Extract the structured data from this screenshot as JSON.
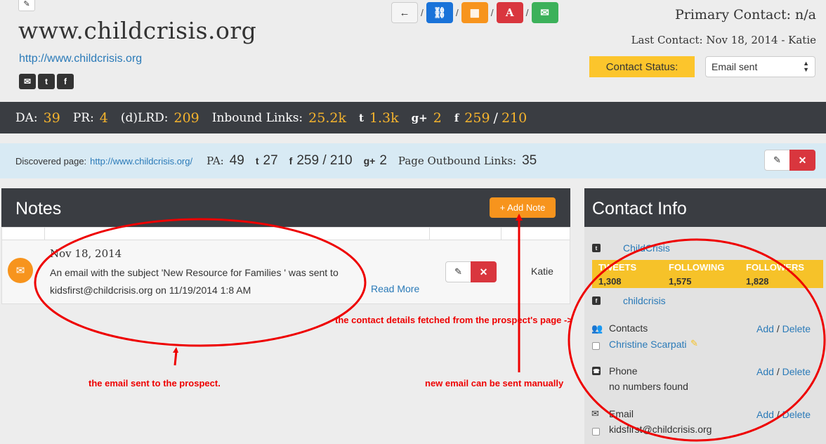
{
  "header": {
    "site_title": "www.childcrisis.org",
    "site_url": "http://www.childcrisis.org",
    "primary_contact": "Primary Contact: n/a",
    "last_contact": "Last Contact: Nov 18, 2014 - Katie",
    "contact_status_label": "Contact Status:",
    "contact_status_value": "Email sent",
    "social_icons": [
      "email-icon",
      "twitter-icon",
      "facebook-icon"
    ],
    "actions": [
      {
        "icon": "arrow-left-icon",
        "color": "#f5f5f5"
      },
      {
        "icon": "link-icon",
        "color": "#1a73d9"
      },
      {
        "icon": "grid-icon",
        "color": "#f7941d"
      },
      {
        "icon": "text-a-icon",
        "color": "#d9363e"
      },
      {
        "icon": "envelope-icon",
        "color": "#3cb15a"
      }
    ]
  },
  "metrics": {
    "da_label": "DA:",
    "da": "39",
    "pr_label": "PR:",
    "pr": "4",
    "lrd_label": "(d)LRD:",
    "lrd": "209",
    "inbound_label": "Inbound Links:",
    "inbound": "25.2k",
    "twitter": "1.3k",
    "gplus": "2",
    "facebook": "259",
    "facebook_sep": "/",
    "facebook2": "210"
  },
  "discovered": {
    "label": "Discovered page:",
    "url": "http://www.childcrisis.org/",
    "pa_label": "PA:",
    "pa": "49",
    "twitter": "27",
    "facebook": "259 / 210",
    "gplus": "2",
    "outbound_label": "Page Outbound Links:",
    "outbound": "35"
  },
  "notes": {
    "title": "Notes",
    "add_button": "+ Add Note",
    "items": [
      {
        "date": "Nov 18, 2014",
        "text": "An email with the subject 'New Resource for Families ' was sent to kidsfirst@childcrisis.org on 11/19/2014 1:8 AM",
        "read_more": "Read More",
        "author": "Katie"
      }
    ]
  },
  "contact_info": {
    "title": "Contact Info",
    "twitter_handle": "ChildCrisis",
    "stats": [
      {
        "label": "TWEETS",
        "value": "1,308"
      },
      {
        "label": "FOLLOWING",
        "value": "1,575"
      },
      {
        "label": "FOLLOWERS",
        "value": "1,828"
      }
    ],
    "facebook_handle": "childcrisis",
    "contacts_label": "Contacts",
    "contact_name": "Christine Scarpati",
    "phone_label": "Phone",
    "phone_value": "no numbers found",
    "email_label": "Email",
    "email_value": "kidsfirst@childcrisis.org",
    "add_label": "Add",
    "slash": "/",
    "delete_label": "Delete"
  },
  "annotations": {
    "email_sent": "the email sent to the prospect.",
    "new_email": "new email can be sent manually",
    "contact_details": "the contact details fetched from the prospect's page ->"
  },
  "colors": {
    "accent_orange": "#f7941d",
    "highlight_yellow": "#fcc52c",
    "dark_bar": "#3a3d42",
    "link_blue": "#2a7ab8",
    "annotation_red": "#e00000"
  }
}
